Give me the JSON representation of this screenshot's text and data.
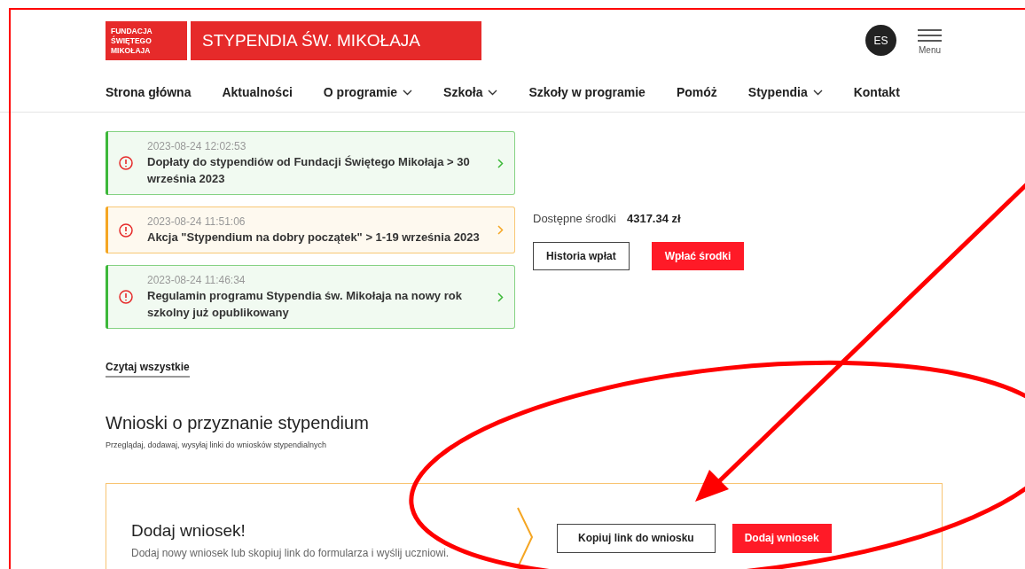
{
  "header": {
    "logo_small": [
      "FUNDACJA",
      "ŚWIĘTEGO",
      "MIKOŁAJA"
    ],
    "logo_title": "STYPENDIA ŚW. MIKOŁAJA",
    "avatar": "ES",
    "menu_label": "Menu"
  },
  "nav": [
    {
      "label": "Strona główna",
      "dropdown": false
    },
    {
      "label": "Aktualności",
      "dropdown": false
    },
    {
      "label": "O programie",
      "dropdown": true
    },
    {
      "label": "Szkoła",
      "dropdown": true
    },
    {
      "label": "Szkoły w programie",
      "dropdown": false
    },
    {
      "label": "Pomóż",
      "dropdown": false
    },
    {
      "label": "Stypendia",
      "dropdown": true
    },
    {
      "label": "Kontakt",
      "dropdown": false
    }
  ],
  "notifications": [
    {
      "time": "2023-08-24 12:02:53",
      "title": "Dopłaty do stypendiów od Fundacji Świętego Mikołaja > 30 września 2023",
      "color": "#3db83a"
    },
    {
      "time": "2023-08-24 11:51:06",
      "title": "Akcja \"Stypendium na dobry początek\" > 1-19 września 2023",
      "color": "#f5a623"
    },
    {
      "time": "2023-08-24 11:46:34",
      "title": "Regulamin programu Stypendia św. Mikołaja na nowy rok szkolny już opublikowany",
      "color": "#3db83a"
    }
  ],
  "read_all": "Czytaj wszystkie",
  "funds": {
    "label": "Dostępne środki",
    "amount": "4317.34 zł",
    "buttons": [
      "Historia wpłat",
      "Wpłać środki"
    ]
  },
  "applications": {
    "title": "Wnioski o przyznanie stypendium",
    "subtitle": "Przeglądaj, dodawaj, wysyłaj linki do wniosków stypendialnych",
    "panel": {
      "title": "Dodaj wniosek!",
      "text": "Dodaj nowy wniosek lub skopiuj link do formularza i wyślij uczniowi.",
      "buttons": [
        "Kopiuj link do wniosku",
        "Dodaj wniosek"
      ]
    }
  }
}
